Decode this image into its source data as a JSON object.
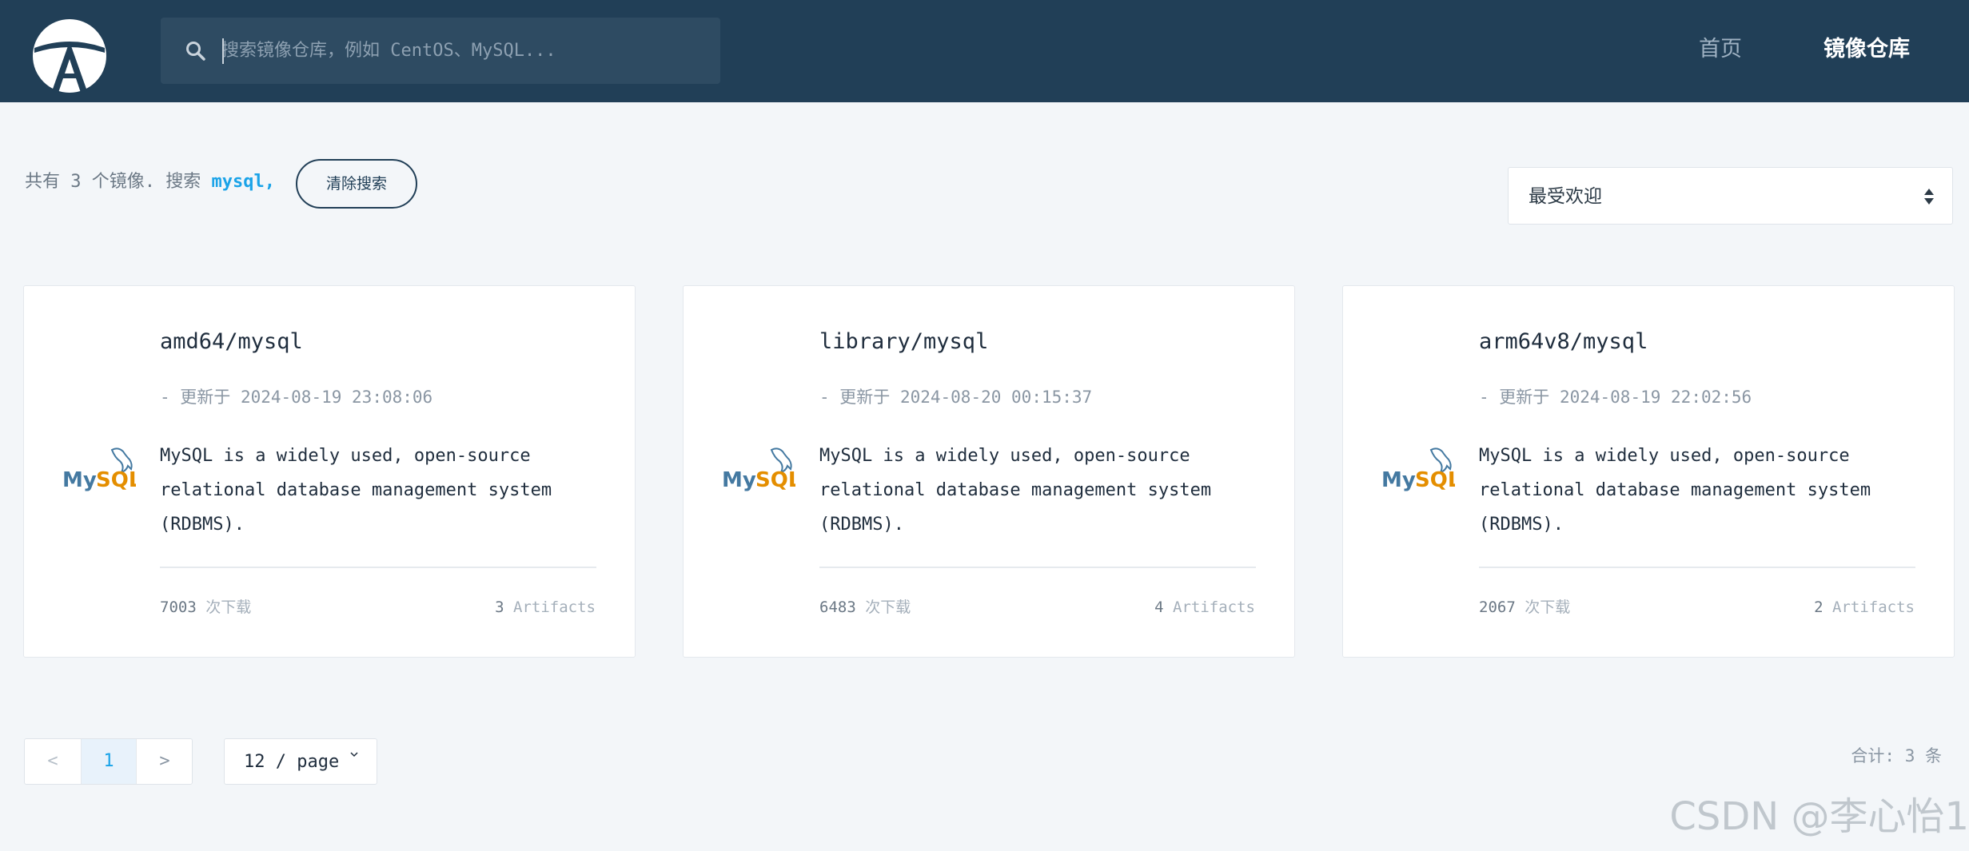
{
  "header": {
    "logo": "app-logo",
    "search": {
      "placeholder": "搜索镜像仓库，例如 CentOS、MySQL...",
      "value": "",
      "icon": "search-icon"
    },
    "nav": [
      {
        "label": "首页",
        "active": false
      },
      {
        "label": "镜像仓库",
        "active": true
      }
    ]
  },
  "summary": {
    "prefix": "共有",
    "count": "3",
    "middle": "个镜像. 搜索",
    "keyword": "mysql,",
    "clear_label": "清除搜索"
  },
  "sort": {
    "selected": "最受欢迎",
    "icon": "sort-arrows-icon"
  },
  "cards": [
    {
      "title": "amd64/mysql",
      "updated_prefix": "- 更新于",
      "updated": "2024-08-19 23:08:06",
      "description": "MySQL is a widely used, open-source relational database management system (RDBMS).",
      "downloads": "7003",
      "downloads_unit": "次下载",
      "artifacts": "3",
      "artifacts_unit": "Artifacts",
      "logo": "mysql-logo"
    },
    {
      "title": "library/mysql",
      "updated_prefix": "- 更新于",
      "updated": "2024-08-20 00:15:37",
      "description": "MySQL is a widely used, open-source relational database management system (RDBMS).",
      "downloads": "6483",
      "downloads_unit": "次下载",
      "artifacts": "4",
      "artifacts_unit": "Artifacts",
      "logo": "mysql-logo"
    },
    {
      "title": "arm64v8/mysql",
      "updated_prefix": "- 更新于",
      "updated": "2024-08-19 22:02:56",
      "description": "MySQL is a widely used, open-source relational database management system (RDBMS).",
      "downloads": "2067",
      "downloads_unit": "次下载",
      "artifacts": "2",
      "artifacts_unit": "Artifacts",
      "logo": "mysql-logo"
    }
  ],
  "pagination": {
    "prev": "<",
    "current_page": "1",
    "next": ">",
    "page_size": "12 / page",
    "total_prefix": "合计:",
    "total": "3",
    "total_suffix": "条"
  },
  "watermark": "CSDN @李心怡1",
  "colors": {
    "header_bg": "#213f57",
    "accent": "#1aa3e8",
    "page_bg": "#f3f6f9"
  }
}
